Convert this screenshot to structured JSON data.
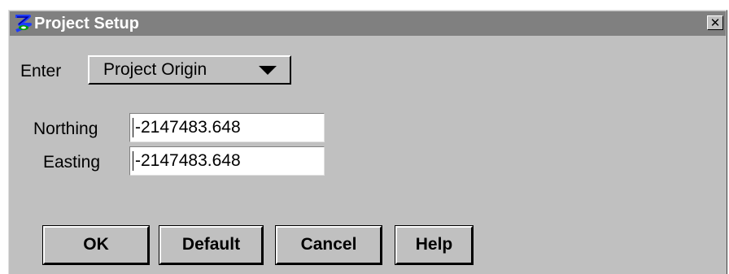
{
  "window": {
    "title": "Project Setup",
    "close_symbol": "✕",
    "app_icon": "setup-app-icon"
  },
  "enter": {
    "label": "Enter",
    "selected": "Project Origin"
  },
  "fields": {
    "northing_label": "Northing",
    "northing_value": "-2147483.648",
    "easting_label": "Easting",
    "easting_value": "-2147483.648"
  },
  "buttons": {
    "ok": "OK",
    "default": "Default",
    "cancel": "Cancel",
    "help": "Help"
  },
  "colors": {
    "titlebar": "#808080",
    "dialog_bg": "#c0c0c0",
    "icon_blue": "#1e3cff",
    "icon_green": "#00a000"
  }
}
